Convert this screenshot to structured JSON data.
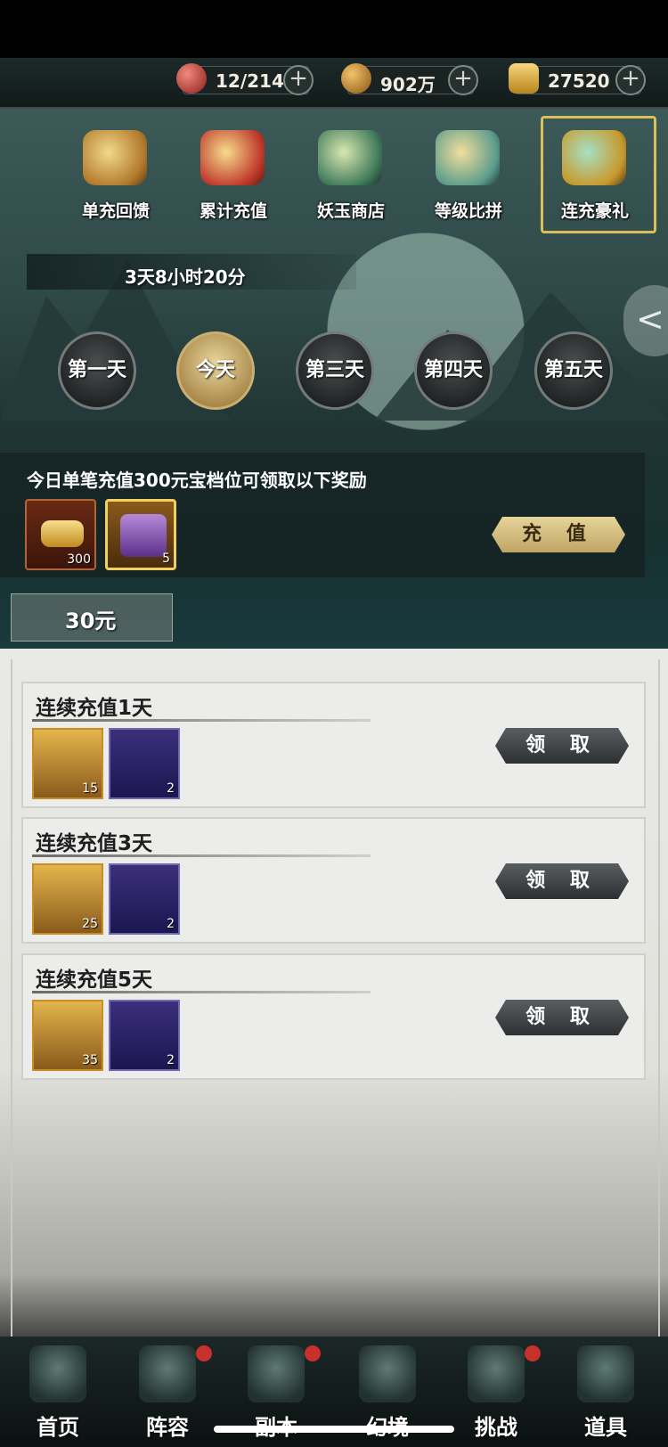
{
  "resources": [
    {
      "icon": "red-orb-icon",
      "value": "12/214"
    },
    {
      "icon": "copper-coin-icon",
      "value": "902万"
    },
    {
      "icon": "gold-ingot-icon",
      "value": "27520"
    }
  ],
  "tabs": [
    {
      "label": "单充回馈",
      "icon": "coin-pile-icon"
    },
    {
      "label": "累计充值",
      "icon": "treasure-icon"
    },
    {
      "label": "妖玉商店",
      "icon": "jade-shop-icon"
    },
    {
      "label": "等级比拼",
      "icon": "level-contest-icon"
    },
    {
      "label": "连充豪礼",
      "icon": "gift-chest-icon"
    }
  ],
  "timer": "3天8小时20分",
  "days": [
    "第一天",
    "今天",
    "第三天",
    "第四天",
    "第五天"
  ],
  "selected_day_index": 1,
  "reward": {
    "description": "今日单笔充值300元宝档位可领取以下奖励",
    "items": [
      {
        "icon": "gold-ingot-icon",
        "count": "300"
      },
      {
        "icon": "treasure-chest-icon",
        "count": "5"
      }
    ],
    "charge_label": "充 值"
  },
  "price": "30元",
  "cards": [
    {
      "title": "连续充值1天",
      "chest_count": "15",
      "dragon_count": "2",
      "claim_label": "领 取"
    },
    {
      "title": "连续充值3天",
      "chest_count": "25",
      "dragon_count": "2",
      "claim_label": "领 取"
    },
    {
      "title": "连续充值5天",
      "chest_count": "35",
      "dragon_count": "2",
      "claim_label": "领 取"
    }
  ],
  "nav": [
    {
      "label": "首页",
      "icon": "home-icon",
      "badge": false
    },
    {
      "label": "阵容",
      "icon": "lineup-icon",
      "badge": true
    },
    {
      "label": "副本",
      "icon": "dungeon-icon",
      "badge": true
    },
    {
      "label": "幻境",
      "icon": "illusion-icon",
      "badge": false
    },
    {
      "label": "挑战",
      "icon": "challenge-icon",
      "badge": true
    },
    {
      "label": "道具",
      "icon": "items-icon",
      "badge": false
    }
  ]
}
